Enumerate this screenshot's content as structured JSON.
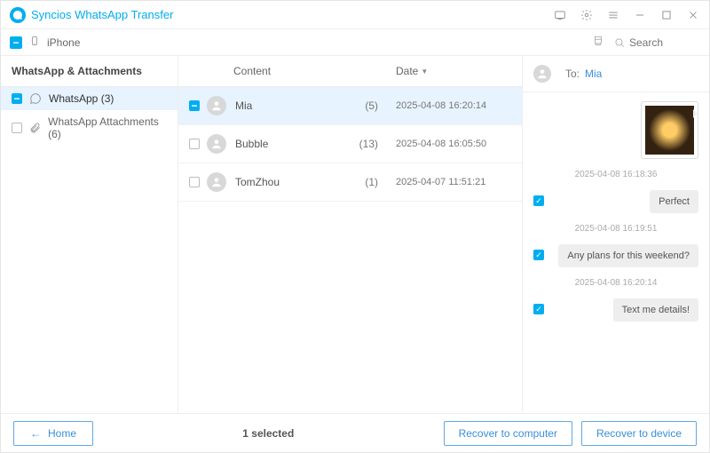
{
  "app": {
    "title": "Syncios WhatsApp Transfer"
  },
  "device": {
    "name": "iPhone"
  },
  "search": {
    "placeholder": "Search"
  },
  "sidebar": {
    "header": "WhatsApp & Attachments",
    "items": [
      {
        "label": "WhatsApp (3)",
        "active": true
      },
      {
        "label": "WhatsApp Attachments (6)",
        "active": false
      }
    ]
  },
  "list": {
    "columns": {
      "content": "Content",
      "date": "Date"
    },
    "rows": [
      {
        "name": "Mia",
        "count": "(5)",
        "date": "2025-04-08 16:20:14",
        "selected": true
      },
      {
        "name": "Bubble",
        "count": "(13)",
        "date": "2025-04-08 16:05:50",
        "selected": false
      },
      {
        "name": "TomZhou",
        "count": "(1)",
        "date": "2025-04-07 11:51:21",
        "selected": false
      }
    ]
  },
  "conversation": {
    "to_label": "To:",
    "to_name": "Mia",
    "messages": [
      {
        "type": "image",
        "time": "2025-04-08 16:18:36"
      },
      {
        "type": "text",
        "text": "Perfect",
        "time": "2025-04-08 16:19:51"
      },
      {
        "type": "text",
        "text": "Any plans for this weekend?",
        "time": "2025-04-08 16:20:14"
      },
      {
        "type": "text",
        "text": "Text me details!",
        "time": ""
      }
    ]
  },
  "footer": {
    "home": "Home",
    "status": "1 selected",
    "recover_computer": "Recover to computer",
    "recover_device": "Recover to device"
  }
}
